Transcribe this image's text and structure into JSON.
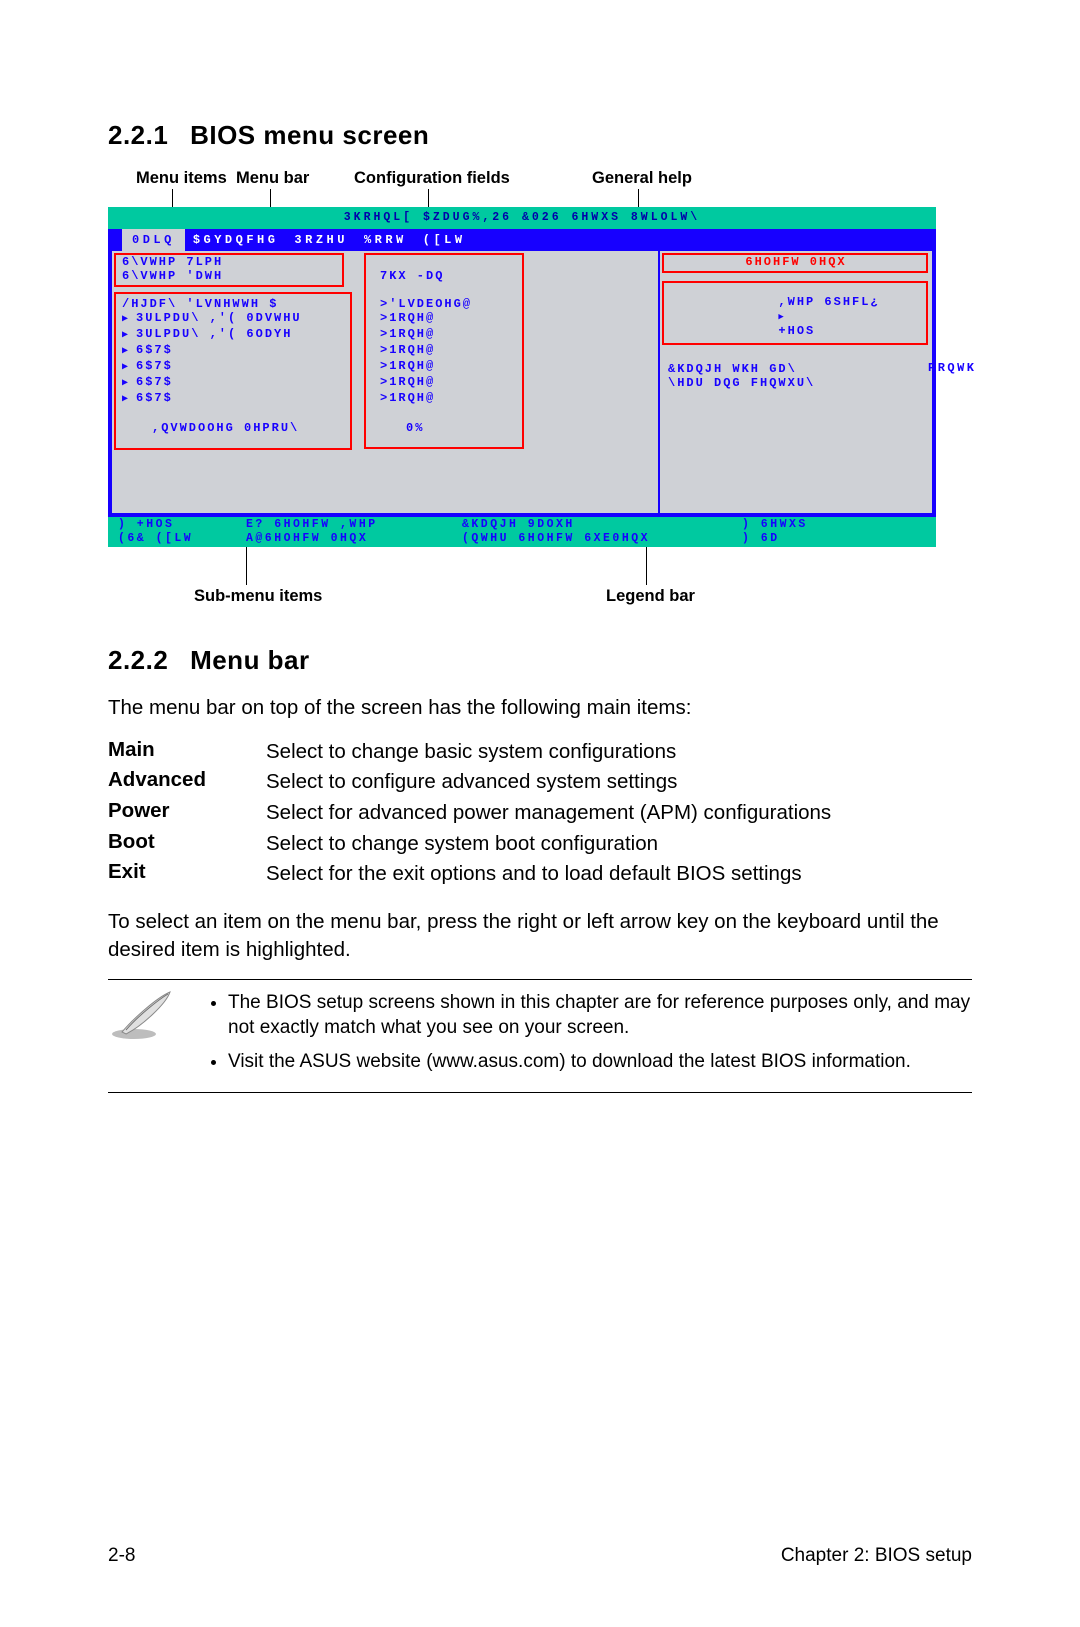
{
  "section221": {
    "number": "2.2.1",
    "title": "BIOS menu screen"
  },
  "anno_top": {
    "menu_items": "Menu items",
    "menu_bar": "Menu bar",
    "config_fields": "Configuration fields",
    "general_help": "General help"
  },
  "bios": {
    "title": "3KRHQL[ $ZDUG%,26 &026 6HWXS 8WLOLW\\",
    "menu": [
      "0DLQ",
      "$GYDQFHG",
      "3RZHU",
      "%RRW",
      "([LW"
    ],
    "left_rows": [
      {
        "l": "6\\VWHP 7LPH",
        "v": ""
      },
      {
        "l": "6\\VWHP 'DWH",
        "v": "7KX -DQ"
      },
      {
        "l": "",
        "v": ""
      },
      {
        "l": "/HJDF\\ 'LVNHWWH $",
        "v": ">'LVDEOHG@"
      },
      {
        "l": "3ULPDU\\ ,'( 0DVWHU",
        "v": ">1RQH@",
        "s": true
      },
      {
        "l": "3ULPDU\\ ,'( 6ODYH",
        "v": ">1RQH@",
        "s": true
      },
      {
        "l": "6$7$",
        "v": ">1RQH@",
        "s": true
      },
      {
        "l": "6$7$",
        "v": ">1RQH@",
        "s": true
      },
      {
        "l": "6$7$",
        "v": ">1RQH@",
        "s": true
      },
      {
        "l": "6$7$",
        "v": ">1RQH@",
        "s": true
      },
      {
        "l": "",
        "v": ""
      },
      {
        "l": ",QVWDOOHG 0HPRU\\",
        "v": "0%",
        "c": true
      }
    ],
    "right": {
      "select_menu": "6HOHFW 0HQX",
      "item_help_l": ",WHP 6SHFL¿",
      "item_help_r": "+HOS",
      "desc1": "&KDQJH WKH GD\\",
      "desc2": "\\HDU DQG FHQWXU\\",
      "overflow": "PRQWK"
    },
    "legend": {
      "r1c1": ") +HOS",
      "r1c2": "E? 6HOHFW ,WHP",
      "r1c3": "&KDQJH 9DOXH",
      "r1c4": ") 6HWXS",
      "r2c1": "(6& ([LW",
      "r2c2": "A@6HOHFW 0HQX",
      "r2c3": "(QWHU 6HOHFW 6XE0HQX",
      "r2c4": ") 6D"
    }
  },
  "anno_bottom": {
    "sub_menu": "Sub-menu items",
    "legend_bar": "Legend bar"
  },
  "section222": {
    "number": "2.2.2",
    "title": "Menu bar",
    "intro": "The menu bar on top of the screen has the following main items:",
    "defs": [
      {
        "t": "Main",
        "d": "Select to change basic system configurations"
      },
      {
        "t": "Advanced",
        "d": "Select to configure advanced system settings"
      },
      {
        "t": "Power",
        "d": "Select for advanced power management (APM) configurations"
      },
      {
        "t": "Boot",
        "d": "Select to change system boot configuration"
      },
      {
        "t": "Exit",
        "d": "Select for the exit options and to load default BIOS settings"
      }
    ],
    "followup": "To select an item on the menu bar, press the right or left arrow key on the keyboard until the desired item is highlighted."
  },
  "note": {
    "items": [
      "The BIOS setup screens shown in this chapter are for reference purposes only, and may not exactly match what you see on your screen.",
      "Visit the ASUS website (www.asus.com) to download the latest BIOS information."
    ]
  },
  "footer": {
    "left": "2-8",
    "right": "Chapter 2: BIOS setup"
  }
}
